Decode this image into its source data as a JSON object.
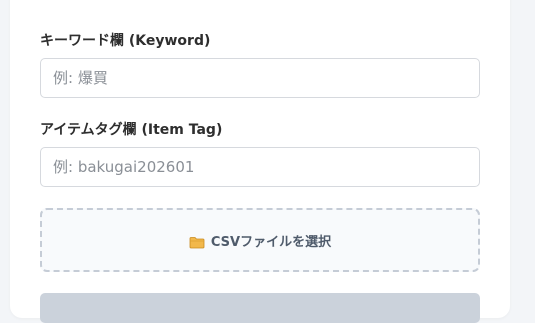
{
  "form": {
    "keyword": {
      "label": "キーワード欄 (Keyword)",
      "placeholder": "例: 爆買",
      "value": ""
    },
    "item_tag": {
      "label": "アイテムタグ欄 (Item Tag)",
      "placeholder": "例: bakugai202601",
      "value": ""
    },
    "csv_picker": {
      "icon": "folder-icon",
      "label": "CSVファイルを選択"
    }
  },
  "colors": {
    "page_background": "#f3f5f8",
    "card_background": "#ffffff",
    "dropzone_border": "#c5ccd6",
    "folder_icon": "#f2b84b",
    "disabled_button": "#cbd2db"
  }
}
